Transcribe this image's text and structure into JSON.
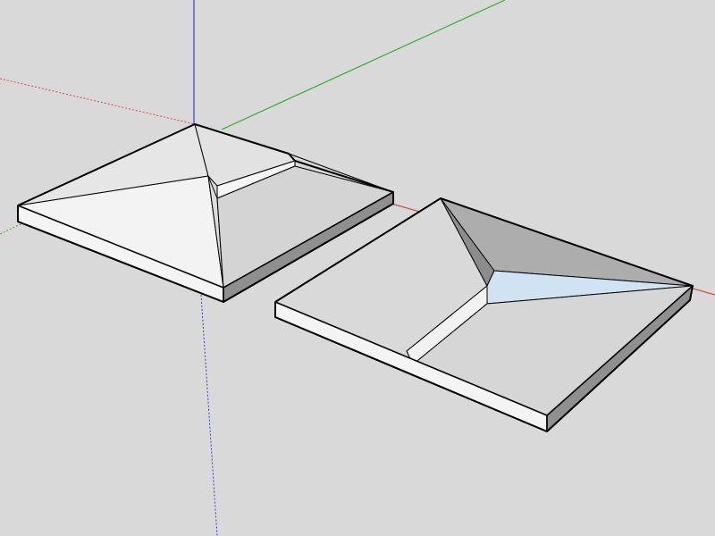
{
  "app": {
    "type": "3d-modeling-viewport"
  },
  "colors": {
    "background": "#d9d9d9",
    "axis_red": "#d94a4a",
    "axis_green": "#2fb12f",
    "axis_blue": "#3a3ad0",
    "edge": "#000000",
    "face_light": "#f2f2f2",
    "face_mid": "#d6d6d6",
    "face_dark": "#a9a9a9",
    "face_blue": "#cfe3f2"
  },
  "scene": {
    "objects": [
      {
        "name": "left-hip-roof-block"
      },
      {
        "name": "right-inverted-hip-block"
      }
    ],
    "axes": [
      {
        "name": "red-axis"
      },
      {
        "name": "green-axis"
      },
      {
        "name": "blue-axis"
      }
    ]
  }
}
